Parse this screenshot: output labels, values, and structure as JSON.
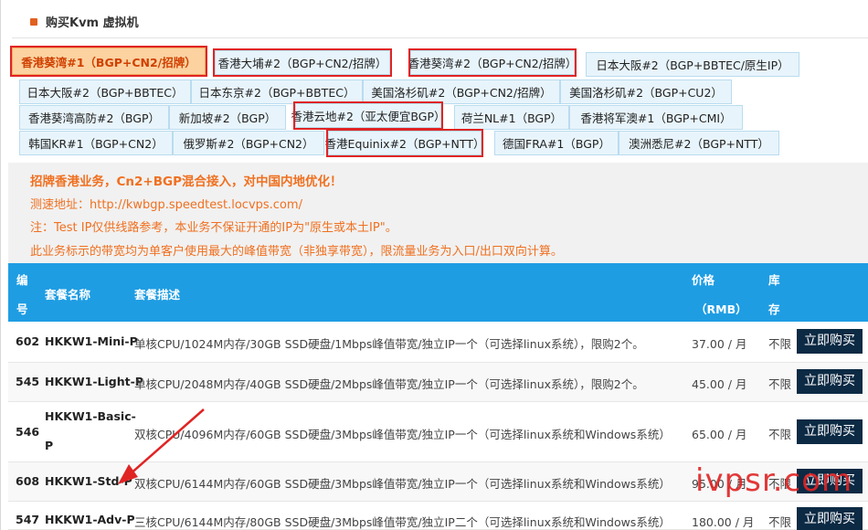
{
  "header": {
    "title": "购买Kvm 虚拟机",
    "icon": "square-bullet-icon"
  },
  "tabs": [
    {
      "label": "香港葵湾#1（BGP+CN2/招牌）",
      "active": true,
      "marked": true
    },
    {
      "label": "香港大埔#2（BGP+CN2/招牌）",
      "marked": true
    },
    {
      "label": "香港葵湾#2（BGP+CN2/招牌）",
      "marked": true
    },
    {
      "label": "日本大阪#2（BGP+BBTEC/原生IP）"
    },
    {
      "label": "日本大阪#2（BGP+BBTEC）"
    },
    {
      "label": "日本东京#2（BGP+BBTEC）"
    },
    {
      "label": "美国洛杉矶#2（BGP+CN2/招牌）"
    },
    {
      "label": "美国洛杉矶#2（BGP+CU2）"
    },
    {
      "label": "香港葵湾高防#2（BGP）"
    },
    {
      "label": "新加坡#2（BGP）"
    },
    {
      "label": "香港云地#2（亚太便宜BGP）",
      "marked": true
    },
    {
      "label": "荷兰NL#1（BGP）"
    },
    {
      "label": "香港将军澳#1（BGP+CMI）"
    },
    {
      "label": "韩国KR#1（BGP+CN2）"
    },
    {
      "label": "俄罗斯#2（BGP+CN2）"
    },
    {
      "label": "香港Equinix#2（BGP+NTT）",
      "marked": true
    },
    {
      "label": "德国FRA#1（BGP）"
    },
    {
      "label": "澳洲悉尼#2（BGP+NTT）"
    }
  ],
  "notice": {
    "line1": "招牌香港业务，Cn2+BGP混合接入，对中国内地优化！",
    "line2": "测速地址：http://kwbgp.speedtest.locvps.com/",
    "line3": "注：Test IP仅供线路参考，本业务不保证开通的IP为\"原生或本土IP\"。",
    "line4": "此业务标示的带宽均为单客户使用最大的峰值带宽（非独享带宽），限流量业务为入口/出口双向计算。"
  },
  "table": {
    "headers": {
      "id_a": "编",
      "id_b": "号",
      "name": "套餐名称",
      "desc": "套餐描述",
      "price_a": "价格",
      "price_b": "（RMB）",
      "stock_a": "库",
      "stock_b": "存"
    },
    "rows": [
      {
        "id": "602",
        "name": "HKKW1-Mini-P",
        "desc": "单核CPU/1024M内存/30GB SSD硬盘/1Mbps峰值带宽/独立IP一个（可选择linux系统），限购2个。",
        "price": "37.00 / 月",
        "stock": "不限",
        "buy": "立即购买"
      },
      {
        "id": "545",
        "name": "HKKW1-Light-P",
        "desc": "单核CPU/2048M内存/40GB SSD硬盘/2Mbps峰值带宽/独立IP一个（可选择linux系统），限购2个。",
        "price": "45.00 / 月",
        "stock": "不限",
        "buy": "立即购买"
      },
      {
        "id": "546",
        "name_a": "HKKW1-Basic-",
        "name_b": "P",
        "desc": "双核CPU/4096M内存/60GB SSD硬盘/3Mbps峰值带宽/独立IP一个（可选择linux系统和Windows系统）",
        "price": "65.00 / 月",
        "stock": "不限",
        "buy": "立即购买"
      },
      {
        "id": "608",
        "name": "HKKW1-Std-P",
        "desc": "双核CPU/6144M内存/60GB SSD硬盘/3Mbps峰值带宽/独立IP一个（可选择linux系统和Windows系统）",
        "price": "95.00 / 月",
        "stock": "不限",
        "buy": "立即购买"
      },
      {
        "id": "547",
        "name": "HKKW1-Adv-P",
        "desc": "三核CPU/6144M内存/80GB SSD硬盘/3Mbps峰值带宽/独立IP二个（可选择linux系统和Windows系统）",
        "price": "180.00 / 月",
        "stock": "不限",
        "buy": "立即购买"
      }
    ]
  },
  "watermark": "ivpsr.com",
  "colors": {
    "accent": "#1f9de3",
    "notice_text": "#f07020",
    "highlight": "#e02424",
    "buy_button": "#0c2a44"
  }
}
